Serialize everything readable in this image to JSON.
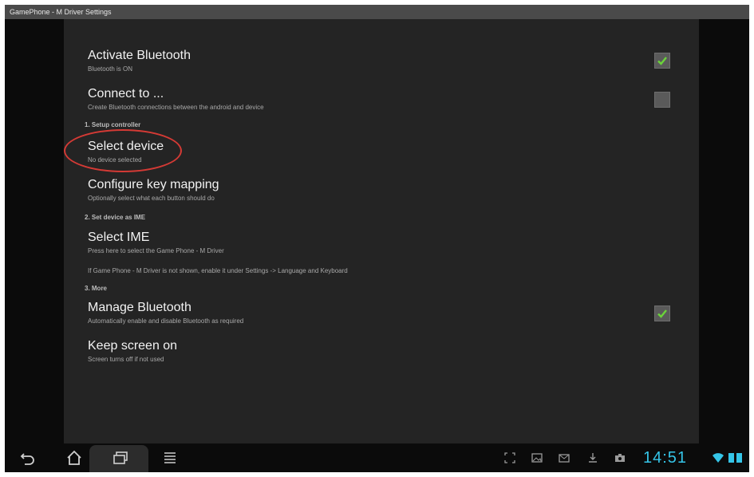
{
  "window": {
    "title": "GamePhone - M Driver Settings"
  },
  "settings": {
    "activate_bluetooth": {
      "title": "Activate Bluetooth",
      "summary": "Bluetooth is ON",
      "checked": true
    },
    "connect_to": {
      "title": "Connect to ...",
      "summary": "Create Bluetooth connections between the android and device",
      "checked": false
    },
    "section_setup": "1. Setup controller",
    "select_device": {
      "title": "Select device",
      "summary": "No device selected"
    },
    "configure_keys": {
      "title": "Configure key mapping",
      "summary": "Optionally select what each button should do"
    },
    "section_ime": "2. Set device as IME",
    "select_ime": {
      "title": "Select IME",
      "summary": "Press here to select the Game Phone - M Driver"
    },
    "ime_note": "If Game Phone - M Driver is not shown, enable it under Settings -> Language and Keyboard",
    "section_more": "3. More",
    "manage_bluetooth": {
      "title": "Manage Bluetooth",
      "summary": "Automatically enable and disable Bluetooth as required",
      "checked": true
    },
    "keep_screen_on": {
      "title": "Keep screen on",
      "summary": "Screen turns off if not used"
    }
  },
  "status_bar": {
    "time": "14:51"
  },
  "colors": {
    "accent_green": "#6bd43a",
    "highlight_red": "#d43a35",
    "clock_blue": "#35c5e8"
  },
  "icons": {
    "nav": [
      "back-icon",
      "home-icon",
      "recent-apps-icon",
      "menu-icon"
    ],
    "status": [
      "screenshot-icon",
      "gallery-icon",
      "email-icon",
      "download-icon",
      "camera-icon",
      "wifi-icon",
      "battery-icon"
    ]
  }
}
